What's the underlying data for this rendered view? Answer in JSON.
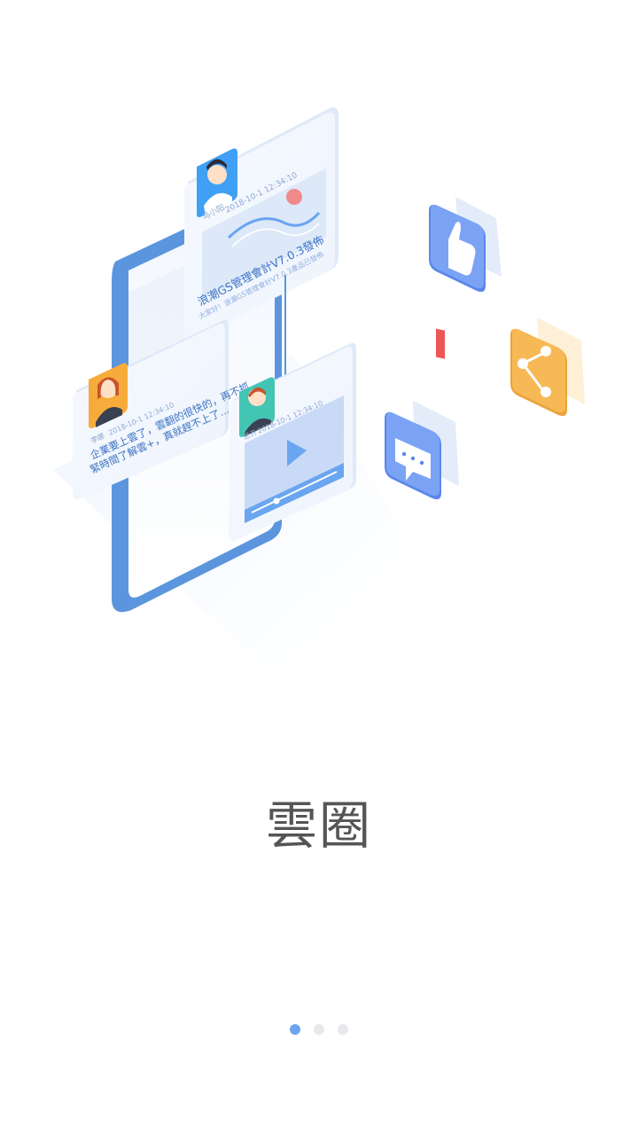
{
  "page": {
    "title": "雲圈",
    "pager": {
      "count": 3,
      "active_index": 0
    }
  },
  "cards": {
    "top": {
      "author": "马小阳",
      "time": "2018-10-1 12:34:10",
      "headline": "浪潮GS管理會計V7.0.3發佈",
      "summary": "大家好！浪潮GS管理會計V7.0.3產品已發佈"
    },
    "left": {
      "author": "李娜",
      "time": "2018-10-1 12:34:10",
      "line1": "企業要上雲了，雲翻的很快的，再不抓",
      "line2": "緊時間了解雲+，真就趕不上了..."
    },
    "video": {
      "author": "思齐",
      "time": "2018-10-1 12:34:10"
    }
  },
  "icons": {
    "like": "thumbs-up-icon",
    "share": "share-icon",
    "chat": "chat-bubble-icon",
    "play": "play-icon"
  },
  "colors": {
    "primary_blue": "#6aa5f0",
    "orange": "#f7b955",
    "red": "#ee5555",
    "dot_inactive": "#e6e8ec",
    "title_text": "#555555"
  }
}
